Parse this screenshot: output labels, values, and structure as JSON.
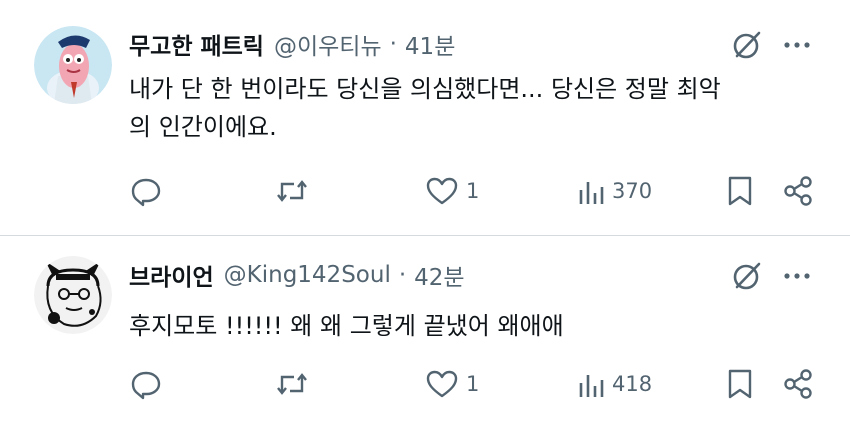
{
  "tweets": [
    {
      "name": "무고한 패트릭",
      "handle": "@이우티뉴",
      "separator": "·",
      "time": "41분",
      "text_line1": "내가 단 한 번이라도 당신을 의심했다면... 당신은 정말 최악",
      "text_line2": "의 인간이에요.",
      "likes": "1",
      "views": "370",
      "avatar_icon": "patrick-avatar"
    },
    {
      "name": "브라이언",
      "handle": "@King142Soul",
      "separator": "·",
      "time": "42분",
      "text_line1": "후지모토 !!!!!! 왜 왜 그렇게 끝냈어 왜애애",
      "likes": "1",
      "views": "418",
      "avatar_icon": "sketch-face-avatar"
    }
  ],
  "icons": [
    "grok-icon",
    "more-icon",
    "reply-icon",
    "retweet-icon",
    "like-icon",
    "views-icon",
    "bookmark-icon",
    "share-icon"
  ],
  "colors": {
    "text": "#0f1419",
    "secondary": "#536471",
    "divider": "#d6dade"
  }
}
